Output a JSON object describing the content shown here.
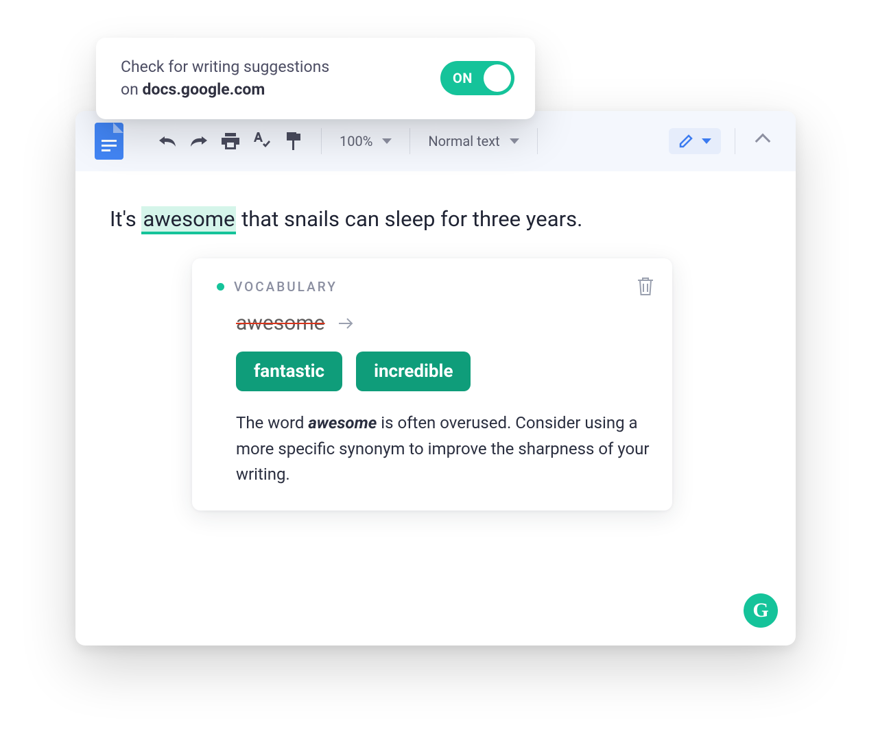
{
  "extension": {
    "line1": "Check for writing suggestions",
    "line2_prefix": "on ",
    "domain": "docs.google.com",
    "toggle_label": "ON",
    "toggle_on": true
  },
  "toolbar": {
    "zoom": "100%",
    "style": "Normal text"
  },
  "document": {
    "sentence_pre": "It's ",
    "highlighted": "awesome",
    "sentence_post": " that snails can sleep for three years."
  },
  "suggestion": {
    "category": "VOCABULARY",
    "original": "awesome",
    "replacements": [
      "fantastic",
      "incredible"
    ],
    "explain_pre": "The word ",
    "explain_word": "awesome",
    "explain_post": " is often overused. Consider using a more specific synonym to improve the sharpness of your writing."
  },
  "badge": {
    "letter": "G"
  }
}
